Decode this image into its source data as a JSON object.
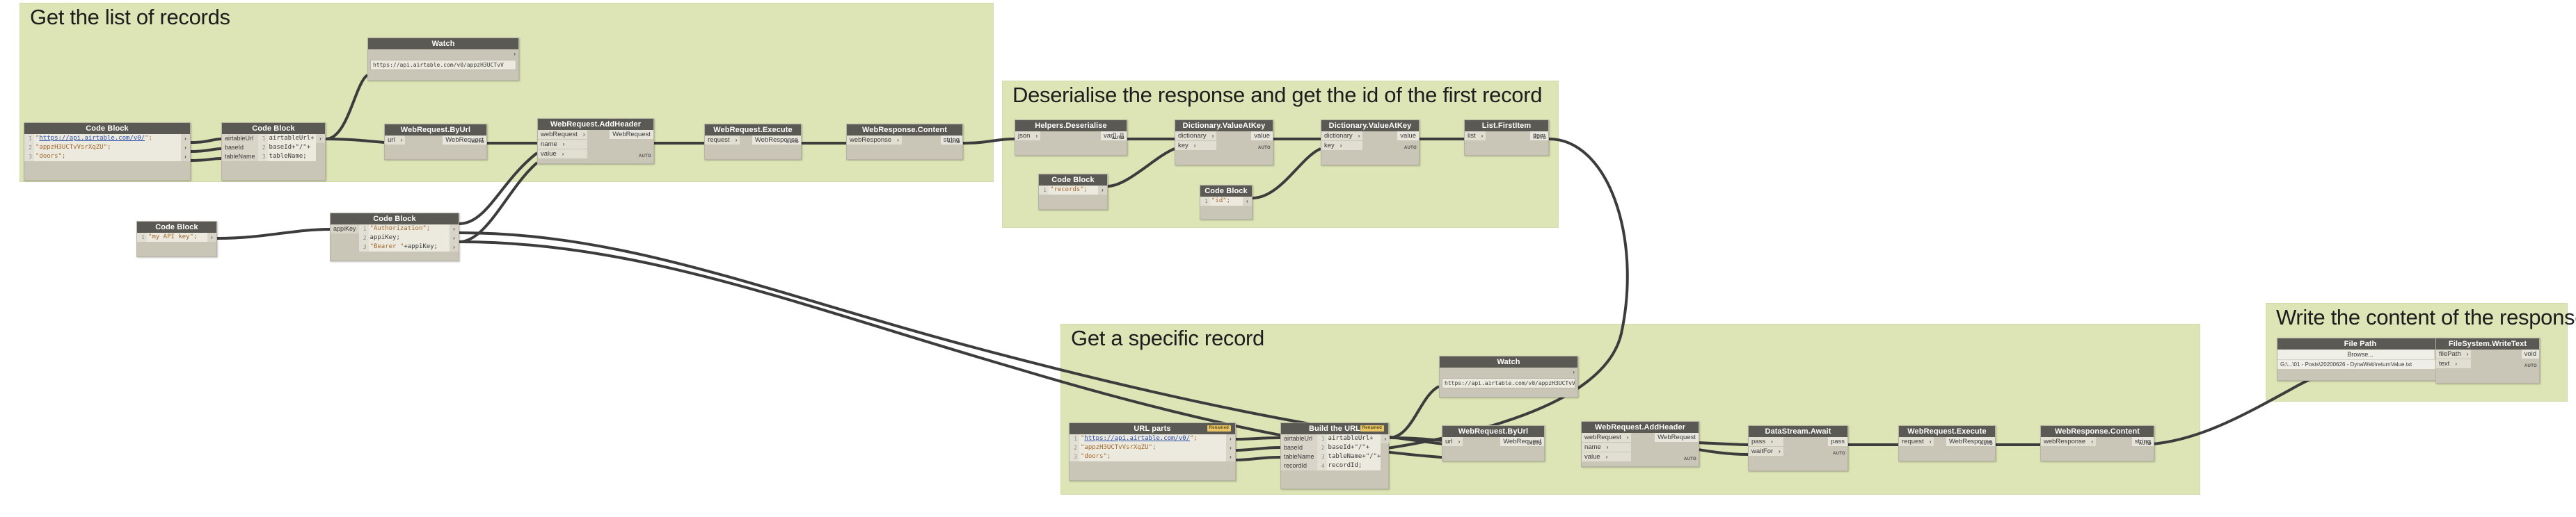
{
  "colors": {
    "group_bg": "#dde5b6",
    "node_body": "#c9c6b8",
    "node_header": "#5b5953",
    "port": "#e1ded2",
    "wire": "#3c3c3c",
    "renamed_badge": "#e8c666"
  },
  "groups": [
    {
      "id": "g1",
      "title": "Get the list of records"
    },
    {
      "id": "g2",
      "title": "Deserialise the response and get the id of the first record"
    },
    {
      "id": "g3",
      "title": "Get a specific record"
    },
    {
      "id": "g4",
      "title": "Write the content of the response"
    }
  ],
  "labels": {
    "auto": "AUTO",
    "renamed": "Renamed",
    "chevron": "›",
    "browse": "Browse..."
  },
  "nodes": {
    "watch_top": {
      "title": "Watch",
      "value": "https://api.airtable.com/v0/appzH3UCTvV"
    },
    "cb_urlparts_top": {
      "title": "Code Block",
      "lines": [
        {
          "n": "1",
          "prefix": "\"",
          "url": "https://api.airtable.com/v0/",
          "suffix": "\";"
        },
        {
          "n": "2",
          "str": "\"appzH3UCTvVsrXqZU\";"
        },
        {
          "n": "3",
          "str": "\"doors\";"
        }
      ]
    },
    "cb_buildurl_top": {
      "title": "Code Block",
      "vars": [
        "airtableUrl",
        "baseId",
        "tableName"
      ],
      "lines": [
        {
          "n": "1",
          "txt": "airtableUrl+"
        },
        {
          "n": "2",
          "txt": "baseId+\"/\"+"
        },
        {
          "n": "3",
          "txt": "tableName;"
        }
      ]
    },
    "wr_byurl_top": {
      "title": "WebRequest.ByUrl",
      "inputs": [
        "url"
      ],
      "outputs": [
        "WebRequest"
      ]
    },
    "wr_addheader_top": {
      "title": "WebRequest.AddHeader",
      "inputs": [
        "webRequest",
        "name",
        "value"
      ],
      "outputs": [
        "WebRequest"
      ]
    },
    "wr_execute_top": {
      "title": "WebRequest.Execute",
      "inputs": [
        "request"
      ],
      "outputs": [
        "WebResponse"
      ]
    },
    "wr_content_top": {
      "title": "WebResponse.Content",
      "inputs": [
        "webResponse"
      ],
      "outputs": [
        "string"
      ]
    },
    "helpers_deser": {
      "title": "Helpers.Deserialise",
      "inputs": [
        "json"
      ],
      "outputs": [
        "var[]..[]"
      ]
    },
    "cb_records": {
      "title": "Code Block",
      "lines": [
        {
          "n": "1",
          "str": "\"records\";"
        }
      ]
    },
    "dict_valuekey_1": {
      "title": "Dictionary.ValueAtKey",
      "inputs": [
        "dictionary",
        "key"
      ],
      "outputs": [
        "value"
      ]
    },
    "cb_id": {
      "title": "Code Block",
      "lines": [
        {
          "n": "1",
          "str": "\"id\";"
        }
      ]
    },
    "dict_valuekey_2": {
      "title": "Dictionary.ValueAtKey",
      "inputs": [
        "dictionary",
        "key"
      ],
      "outputs": [
        "value"
      ]
    },
    "list_firstitem": {
      "title": "List.FirstItem",
      "inputs": [
        "list"
      ],
      "outputs": [
        "item"
      ]
    },
    "cb_apikey": {
      "title": "Code Block",
      "lines": [
        {
          "n": "1",
          "str": "\"my API key\";"
        }
      ]
    },
    "cb_auth": {
      "title": "Code Block",
      "vars": [
        "appiKey"
      ],
      "lines": [
        {
          "n": "1",
          "str": "\"Authorization\";"
        },
        {
          "n": "2",
          "txt": "appiKey;"
        },
        {
          "n": "3",
          "str": "\"Bearer \"",
          "txt2": "+appiKey;"
        }
      ]
    },
    "cb_urlparts_bot": {
      "title": "URL parts",
      "renamed": true,
      "lines": [
        {
          "n": "1",
          "prefix": "\"",
          "url": "https://api.airtable.com/v0/",
          "suffix": "\";"
        },
        {
          "n": "2",
          "str": "\"appzH3UCTvVsrXqZU\";"
        },
        {
          "n": "3",
          "str": "\"doors\";"
        }
      ]
    },
    "cb_buildurl_bot": {
      "title": "Build the URL",
      "renamed": true,
      "vars": [
        "airtableUrl",
        "baseId",
        "tableName",
        "recordId"
      ],
      "lines": [
        {
          "n": "1",
          "txt": "airtableUrl+"
        },
        {
          "n": "2",
          "txt": "baseId+\"/\"+"
        },
        {
          "n": "3",
          "txt": "tableName+\"/\"+"
        },
        {
          "n": "4",
          "txt": "recordId;"
        }
      ]
    },
    "watch_bot": {
      "title": "Watch",
      "value": "https://api.airtable.com/v0/appzH3UCTvV"
    },
    "wr_byurl_bot": {
      "title": "WebRequest.ByUrl",
      "inputs": [
        "url"
      ],
      "outputs": [
        "WebRequest"
      ]
    },
    "wr_addheader_bot": {
      "title": "WebRequest.AddHeader",
      "inputs": [
        "webRequest",
        "name",
        "value"
      ],
      "outputs": [
        "WebRequest"
      ]
    },
    "datastream_await": {
      "title": "DataStream.Await",
      "inputs": [
        "pass",
        "waitFor"
      ],
      "outputs": [
        "pass"
      ]
    },
    "wr_execute_bot": {
      "title": "WebRequest.Execute",
      "inputs": [
        "request"
      ],
      "outputs": [
        "WebResponse"
      ]
    },
    "wr_content_bot": {
      "title": "WebResponse.Content",
      "inputs": [
        "webResponse"
      ],
      "outputs": [
        "string"
      ]
    },
    "file_path": {
      "title": "File Path",
      "browse": "Browse...",
      "path": "G:\\...\\01 - Posts\\20200626 - DynaWeb\\returnValue.txt"
    },
    "fs_writetext": {
      "title": "FileSystem.WriteText",
      "inputs": [
        "filePath",
        "text"
      ],
      "outputs": [
        "void"
      ]
    }
  }
}
